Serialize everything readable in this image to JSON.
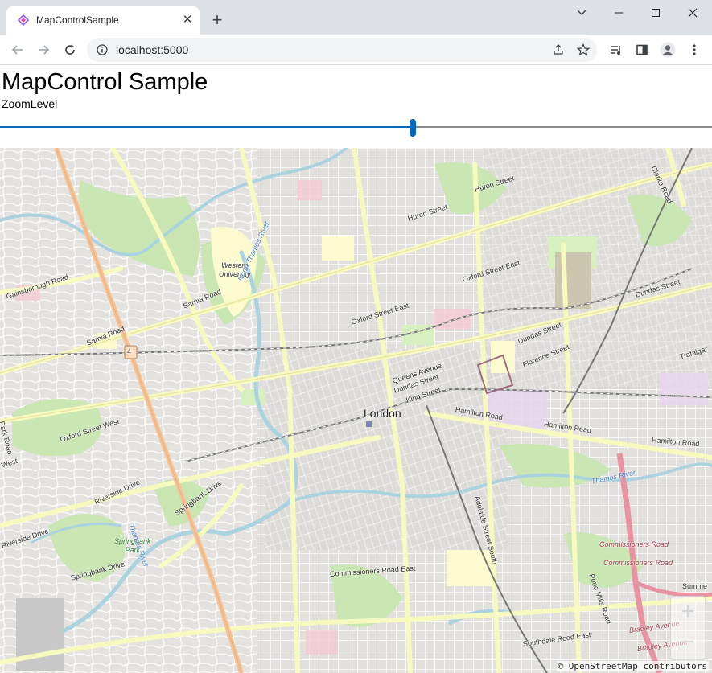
{
  "browser": {
    "tab_title": "MapControlSample",
    "url": "localhost:5000"
  },
  "page": {
    "title": "MapControl Sample",
    "zoom_label": "ZoomLevel",
    "zoom_slider_fraction": 0.58
  },
  "map": {
    "city_label": "London",
    "labels": [
      {
        "text": "Huron Street"
      },
      {
        "text": "Huron Street"
      },
      {
        "text": "Clarke Road"
      },
      {
        "text": "Oxford Street East"
      },
      {
        "text": "Dundas Street"
      },
      {
        "text": "Oxford Street East"
      },
      {
        "text": "Dundas Street"
      },
      {
        "text": "Florence Street"
      },
      {
        "text": "Trafalgar"
      },
      {
        "text": "Queens Avenue"
      },
      {
        "text": "Dundas Street"
      },
      {
        "text": "King Street"
      },
      {
        "text": "Hamilton Road"
      },
      {
        "text": "Hamilton Road"
      },
      {
        "text": "Hamilton Road"
      },
      {
        "text": "Gainsborough Road"
      },
      {
        "text": "Sarnia Road"
      },
      {
        "text": "Sarnia Road"
      },
      {
        "text": "Oxford Street West"
      },
      {
        "text": "West"
      },
      {
        "text": "Park Road"
      },
      {
        "text": "Riverside Drive"
      },
      {
        "text": "Riverside Drive"
      },
      {
        "text": "Springbank Drive"
      },
      {
        "text": "Springbank Drive"
      },
      {
        "text": "Commissioners Road East"
      },
      {
        "text": "Adelaide Street South"
      },
      {
        "text": "Pond Mills Road"
      },
      {
        "text": "Southdale Road East"
      },
      {
        "text": "Summe"
      }
    ],
    "university_label": "Western\nUniversity",
    "park_label": "Springbank\nPark",
    "river_labels": [
      "North Thames River",
      "Thames River",
      "Thames River"
    ],
    "highway_labels": [
      "Commissioners Road",
      "Commissioners Road",
      "Bradley Avenue",
      "Bradley Avenue"
    ],
    "route_shield": "4",
    "zoom_in": "+",
    "zoom_out": "−",
    "attribution": "© OpenStreetMap contributors"
  }
}
